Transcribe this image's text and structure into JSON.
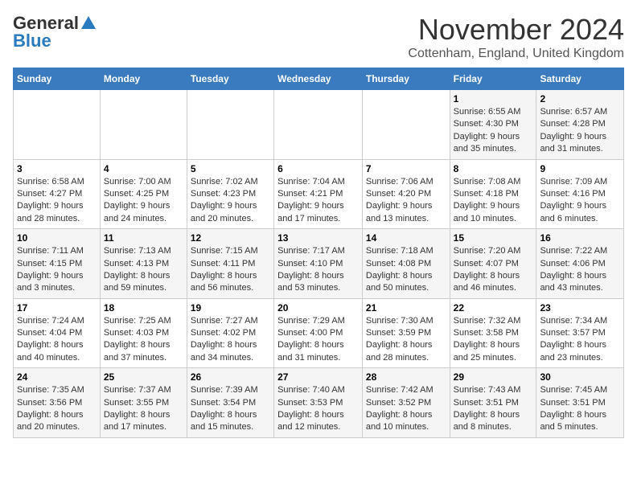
{
  "logo": {
    "general": "General",
    "blue": "Blue"
  },
  "title": "November 2024",
  "location": "Cottenham, England, United Kingdom",
  "days_of_week": [
    "Sunday",
    "Monday",
    "Tuesday",
    "Wednesday",
    "Thursday",
    "Friday",
    "Saturday"
  ],
  "weeks": [
    [
      {
        "day": "",
        "info": ""
      },
      {
        "day": "",
        "info": ""
      },
      {
        "day": "",
        "info": ""
      },
      {
        "day": "",
        "info": ""
      },
      {
        "day": "",
        "info": ""
      },
      {
        "day": "1",
        "info": "Sunrise: 6:55 AM\nSunset: 4:30 PM\nDaylight: 9 hours and 35 minutes."
      },
      {
        "day": "2",
        "info": "Sunrise: 6:57 AM\nSunset: 4:28 PM\nDaylight: 9 hours and 31 minutes."
      }
    ],
    [
      {
        "day": "3",
        "info": "Sunrise: 6:58 AM\nSunset: 4:27 PM\nDaylight: 9 hours and 28 minutes."
      },
      {
        "day": "4",
        "info": "Sunrise: 7:00 AM\nSunset: 4:25 PM\nDaylight: 9 hours and 24 minutes."
      },
      {
        "day": "5",
        "info": "Sunrise: 7:02 AM\nSunset: 4:23 PM\nDaylight: 9 hours and 20 minutes."
      },
      {
        "day": "6",
        "info": "Sunrise: 7:04 AM\nSunset: 4:21 PM\nDaylight: 9 hours and 17 minutes."
      },
      {
        "day": "7",
        "info": "Sunrise: 7:06 AM\nSunset: 4:20 PM\nDaylight: 9 hours and 13 minutes."
      },
      {
        "day": "8",
        "info": "Sunrise: 7:08 AM\nSunset: 4:18 PM\nDaylight: 9 hours and 10 minutes."
      },
      {
        "day": "9",
        "info": "Sunrise: 7:09 AM\nSunset: 4:16 PM\nDaylight: 9 hours and 6 minutes."
      }
    ],
    [
      {
        "day": "10",
        "info": "Sunrise: 7:11 AM\nSunset: 4:15 PM\nDaylight: 9 hours and 3 minutes."
      },
      {
        "day": "11",
        "info": "Sunrise: 7:13 AM\nSunset: 4:13 PM\nDaylight: 8 hours and 59 minutes."
      },
      {
        "day": "12",
        "info": "Sunrise: 7:15 AM\nSunset: 4:11 PM\nDaylight: 8 hours and 56 minutes."
      },
      {
        "day": "13",
        "info": "Sunrise: 7:17 AM\nSunset: 4:10 PM\nDaylight: 8 hours and 53 minutes."
      },
      {
        "day": "14",
        "info": "Sunrise: 7:18 AM\nSunset: 4:08 PM\nDaylight: 8 hours and 50 minutes."
      },
      {
        "day": "15",
        "info": "Sunrise: 7:20 AM\nSunset: 4:07 PM\nDaylight: 8 hours and 46 minutes."
      },
      {
        "day": "16",
        "info": "Sunrise: 7:22 AM\nSunset: 4:06 PM\nDaylight: 8 hours and 43 minutes."
      }
    ],
    [
      {
        "day": "17",
        "info": "Sunrise: 7:24 AM\nSunset: 4:04 PM\nDaylight: 8 hours and 40 minutes."
      },
      {
        "day": "18",
        "info": "Sunrise: 7:25 AM\nSunset: 4:03 PM\nDaylight: 8 hours and 37 minutes."
      },
      {
        "day": "19",
        "info": "Sunrise: 7:27 AM\nSunset: 4:02 PM\nDaylight: 8 hours and 34 minutes."
      },
      {
        "day": "20",
        "info": "Sunrise: 7:29 AM\nSunset: 4:00 PM\nDaylight: 8 hours and 31 minutes."
      },
      {
        "day": "21",
        "info": "Sunrise: 7:30 AM\nSunset: 3:59 PM\nDaylight: 8 hours and 28 minutes."
      },
      {
        "day": "22",
        "info": "Sunrise: 7:32 AM\nSunset: 3:58 PM\nDaylight: 8 hours and 25 minutes."
      },
      {
        "day": "23",
        "info": "Sunrise: 7:34 AM\nSunset: 3:57 PM\nDaylight: 8 hours and 23 minutes."
      }
    ],
    [
      {
        "day": "24",
        "info": "Sunrise: 7:35 AM\nSunset: 3:56 PM\nDaylight: 8 hours and 20 minutes."
      },
      {
        "day": "25",
        "info": "Sunrise: 7:37 AM\nSunset: 3:55 PM\nDaylight: 8 hours and 17 minutes."
      },
      {
        "day": "26",
        "info": "Sunrise: 7:39 AM\nSunset: 3:54 PM\nDaylight: 8 hours and 15 minutes."
      },
      {
        "day": "27",
        "info": "Sunrise: 7:40 AM\nSunset: 3:53 PM\nDaylight: 8 hours and 12 minutes."
      },
      {
        "day": "28",
        "info": "Sunrise: 7:42 AM\nSunset: 3:52 PM\nDaylight: 8 hours and 10 minutes."
      },
      {
        "day": "29",
        "info": "Sunrise: 7:43 AM\nSunset: 3:51 PM\nDaylight: 8 hours and 8 minutes."
      },
      {
        "day": "30",
        "info": "Sunrise: 7:45 AM\nSunset: 3:51 PM\nDaylight: 8 hours and 5 minutes."
      }
    ]
  ]
}
